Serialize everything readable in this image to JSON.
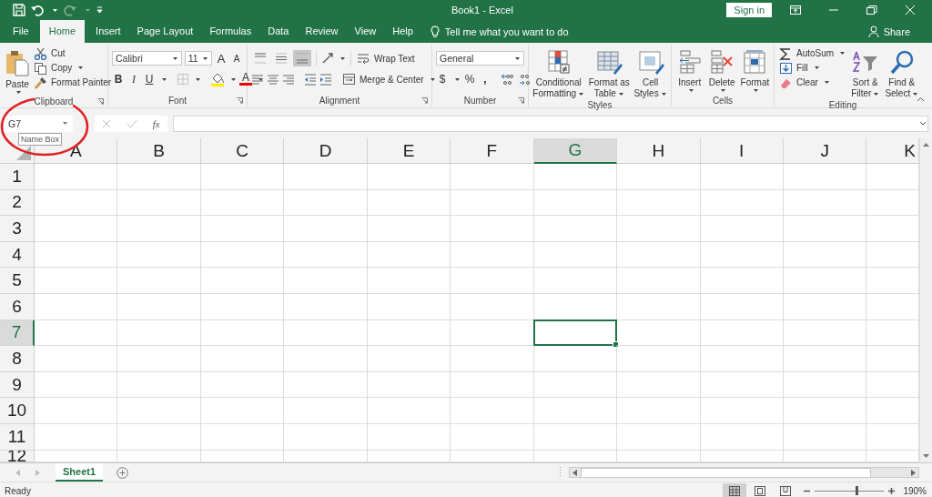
{
  "title_bar": {
    "title": "Book1  -  Excel",
    "sign_in": "Sign in"
  },
  "ribbon_tabs": [
    {
      "label": "File",
      "selected": false
    },
    {
      "label": "Home",
      "selected": true
    },
    {
      "label": "Insert",
      "selected": false
    },
    {
      "label": "Page Layout",
      "selected": false
    },
    {
      "label": "Formulas",
      "selected": false
    },
    {
      "label": "Data",
      "selected": false
    },
    {
      "label": "Review",
      "selected": false
    },
    {
      "label": "View",
      "selected": false
    },
    {
      "label": "Help",
      "selected": false
    }
  ],
  "tell_me": "Tell me what you want to do",
  "share": "Share",
  "clipboard": {
    "label": "Clipboard",
    "paste": "Paste",
    "cut": "Cut",
    "copy": "Copy",
    "format_painter": "Format Painter"
  },
  "font": {
    "label": "Font",
    "font_name": "Calibri",
    "font_size": "11",
    "grow": "A",
    "shrink": "A",
    "bold": "B",
    "italic": "I",
    "underline": "U",
    "font_color": "A"
  },
  "alignment": {
    "label": "Alignment",
    "vertical_align": [
      {
        "kind": "top",
        "selected": false
      },
      {
        "kind": "middle",
        "selected": false
      },
      {
        "kind": "bottom",
        "selected": true
      }
    ],
    "wrap_text": "Wrap Text",
    "merge_center": "Merge & Center"
  },
  "number": {
    "label": "Number",
    "format": "General",
    "currency": "$",
    "percent": "%",
    "comma": ","
  },
  "styles": {
    "label": "Styles",
    "buttons": [
      [
        "Conditional",
        "Formatting"
      ],
      [
        "Format as",
        "Table"
      ],
      [
        "Cell",
        "Styles"
      ]
    ]
  },
  "cells": {
    "label": "Cells",
    "buttons": [
      "Insert",
      "Delete",
      "Format"
    ]
  },
  "editing": {
    "label": "Editing",
    "autosum": "AutoSum",
    "fill": "Fill",
    "clear": "Clear",
    "sort_filter": [
      "Sort &",
      "Filter"
    ],
    "find_select": [
      "Find &",
      "Select"
    ]
  },
  "formula_bar": {
    "name_box": "G7",
    "tooltip": "Name Box",
    "function": "fx"
  },
  "columns": [
    {
      "label": "A",
      "selected": false
    },
    {
      "label": "B",
      "selected": false
    },
    {
      "label": "C",
      "selected": false
    },
    {
      "label": "D",
      "selected": false
    },
    {
      "label": "E",
      "selected": false
    },
    {
      "label": "F",
      "selected": false
    },
    {
      "label": "G",
      "selected": true
    },
    {
      "label": "H",
      "selected": false
    },
    {
      "label": "I",
      "selected": false
    },
    {
      "label": "J",
      "selected": false
    },
    {
      "label": "K",
      "selected": false
    }
  ],
  "rows": [
    {
      "label": "1",
      "selected": false
    },
    {
      "label": "2",
      "selected": false
    },
    {
      "label": "3",
      "selected": false
    },
    {
      "label": "4",
      "selected": false
    },
    {
      "label": "5",
      "selected": false
    },
    {
      "label": "6",
      "selected": false
    },
    {
      "label": "7",
      "selected": true
    },
    {
      "label": "8",
      "selected": false
    },
    {
      "label": "9",
      "selected": false
    },
    {
      "label": "10",
      "selected": false
    },
    {
      "label": "11",
      "selected": false
    },
    {
      "label": "12",
      "selected": false
    }
  ],
  "sheet_tabs": [
    {
      "label": "Sheet1",
      "selected": true
    }
  ],
  "status_bar": {
    "status": "Ready",
    "views": [
      {
        "kind": "normal",
        "selected": true
      },
      {
        "kind": "page_layout",
        "selected": false
      },
      {
        "kind": "page_break",
        "selected": false
      }
    ],
    "zoom": {
      "level": 0.6,
      "label": "190%"
    }
  }
}
